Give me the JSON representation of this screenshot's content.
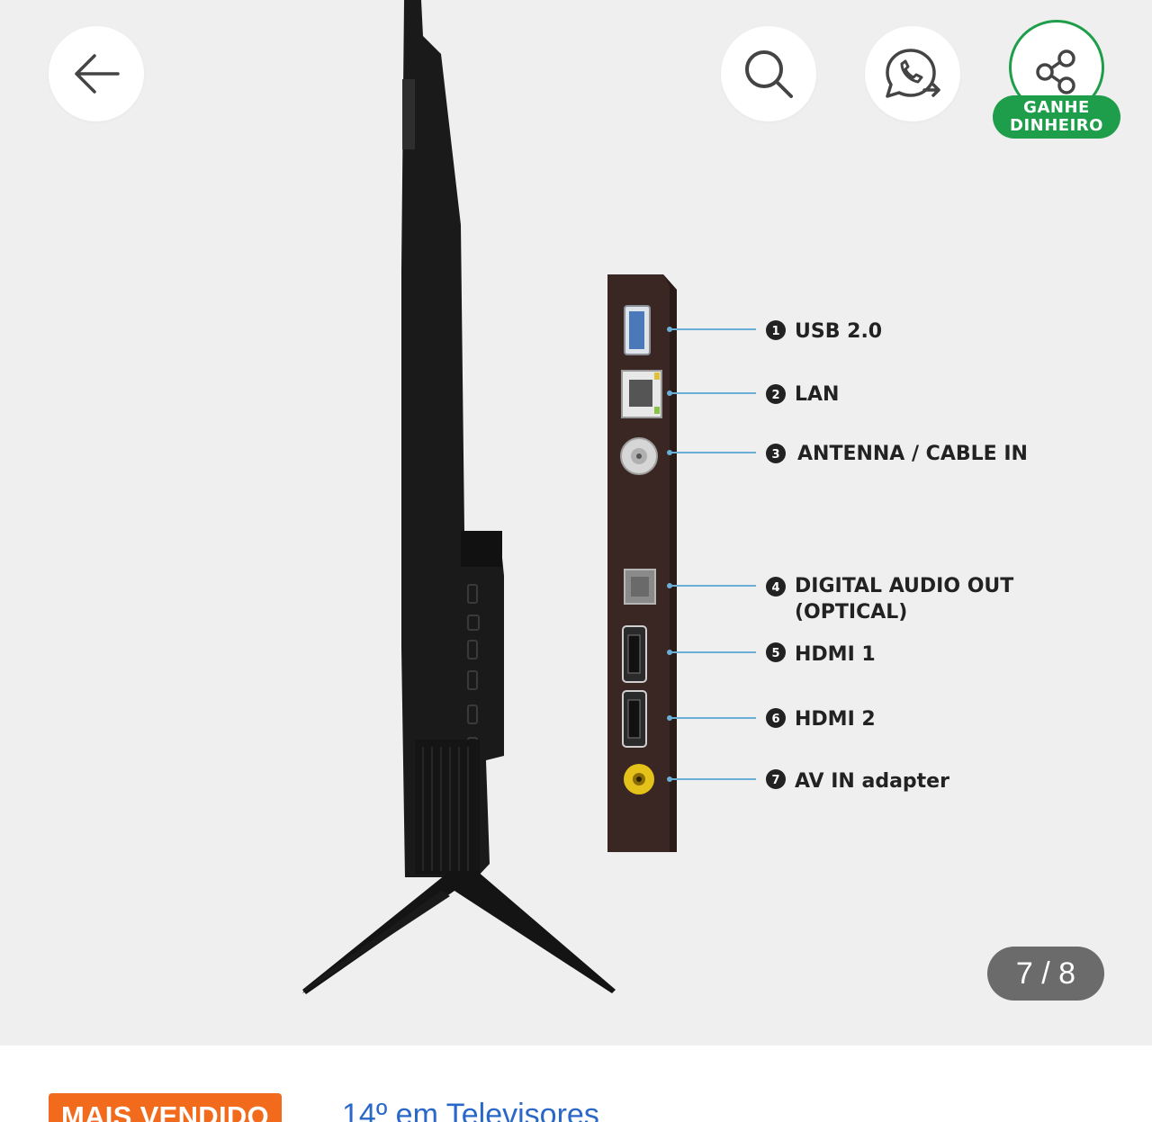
{
  "header": {
    "back_icon": "arrow-left-icon",
    "search_icon": "search-icon",
    "whatsapp_icon": "whatsapp-share-icon",
    "share_icon": "share-icon",
    "earn_line1": "GANHE",
    "earn_line2": "DINHEIRO"
  },
  "gallery": {
    "counter": "7 / 8",
    "current": 7,
    "total": 8,
    "ports": [
      {
        "num": "1",
        "label": "USB 2.0",
        "label2": ""
      },
      {
        "num": "2",
        "label": "LAN",
        "label2": ""
      },
      {
        "num": "3",
        "label": "ANTENNA / CABLE IN",
        "label2": ""
      },
      {
        "num": "4",
        "label": "DIGITAL AUDIO OUT",
        "label2": "(OPTICAL)"
      },
      {
        "num": "5",
        "label": "HDMI 1",
        "label2": ""
      },
      {
        "num": "6",
        "label": "HDMI 2",
        "label2": ""
      },
      {
        "num": "7",
        "label": "AV IN adapter",
        "label2": ""
      }
    ]
  },
  "product": {
    "badge": "MAIS VENDIDO",
    "ranking": "14º em Televisores"
  },
  "colors": {
    "accent_green": "#1e9e4a",
    "badge_orange": "#f26b1d",
    "link_blue": "#2968c8",
    "panel_brown": "#3a2723"
  }
}
